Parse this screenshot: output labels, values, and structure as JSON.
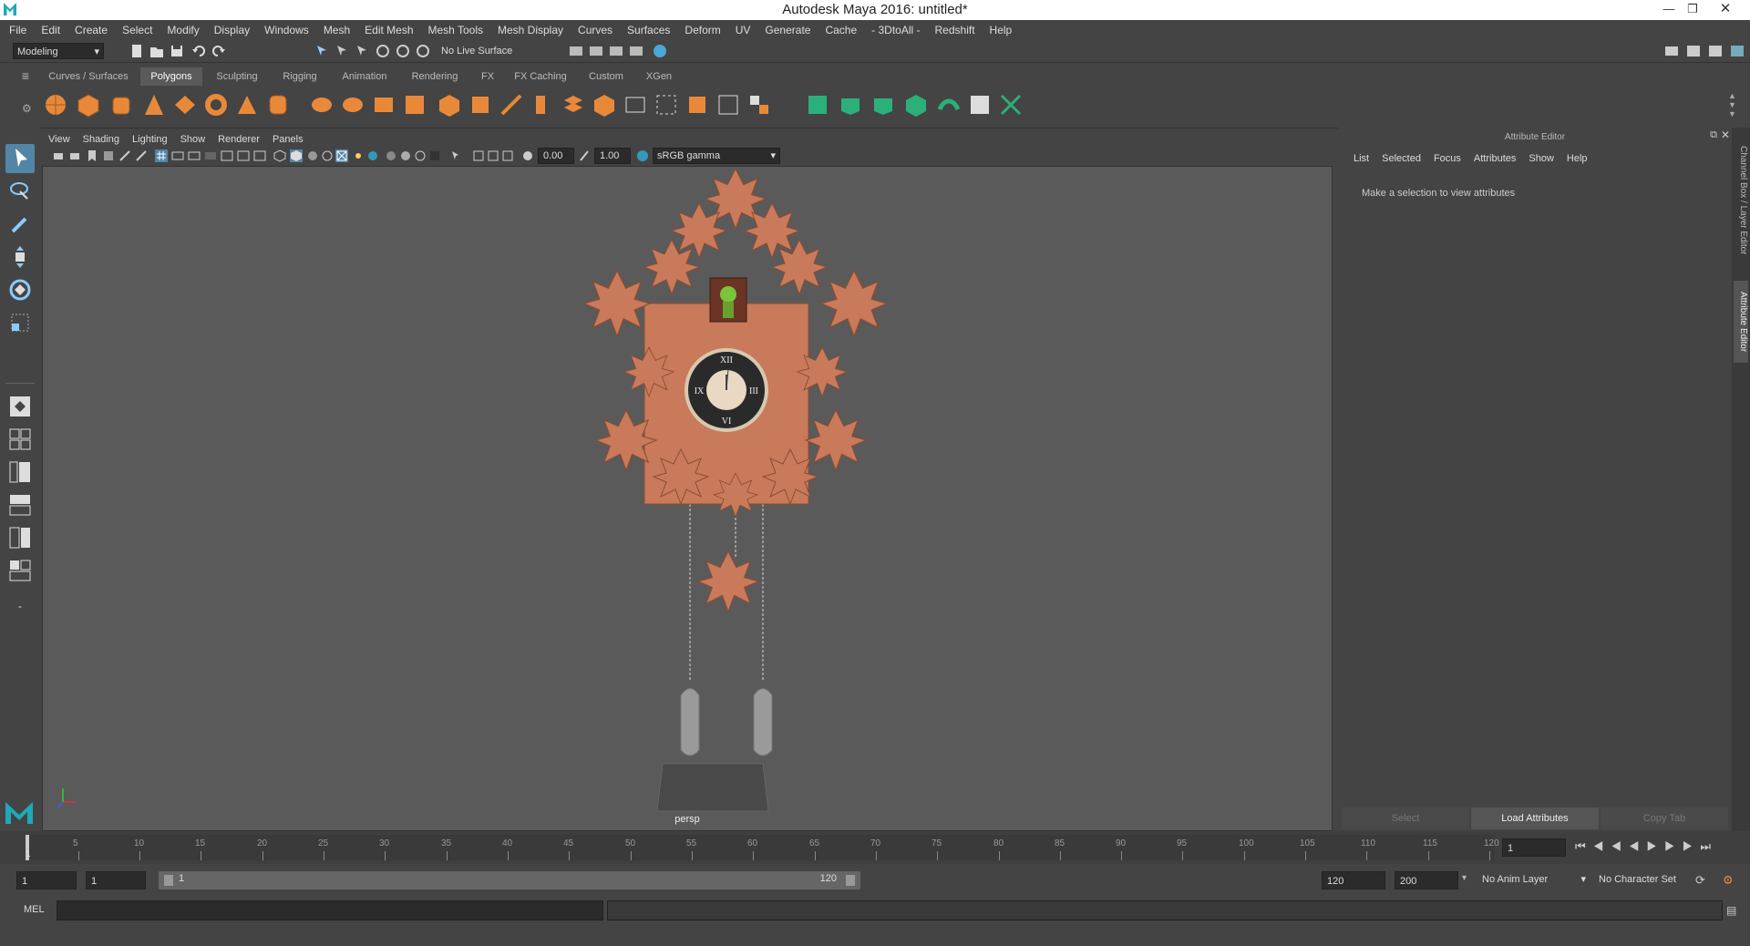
{
  "window": {
    "title": "Autodesk Maya 2016: untitled*"
  },
  "menubar": [
    "File",
    "Edit",
    "Create",
    "Select",
    "Modify",
    "Display",
    "Windows",
    "Mesh",
    "Edit Mesh",
    "Mesh Tools",
    "Mesh Display",
    "Curves",
    "Surfaces",
    "Deform",
    "UV",
    "Generate",
    "Cache",
    "- 3DtoAll -",
    "Redshift",
    "Help"
  ],
  "status": {
    "menuset": "Modeling",
    "live_surface": "No Live Surface"
  },
  "shelf": {
    "tabs": [
      "Curves / Surfaces",
      "Polygons",
      "Sculpting",
      "Rigging",
      "Animation",
      "Rendering",
      "FX",
      "FX Caching",
      "Custom",
      "XGen"
    ],
    "active_tab": "Polygons"
  },
  "viewport": {
    "menu": [
      "View",
      "Shading",
      "Lighting",
      "Show",
      "Renderer",
      "Panels"
    ],
    "exposure": "0.00",
    "gamma": "1.00",
    "color_space": "sRGB gamma",
    "camera_label": "persp"
  },
  "attribute_editor": {
    "header": "Attribute Editor",
    "menu": [
      "List",
      "Selected",
      "Focus",
      "Attributes",
      "Show",
      "Help"
    ],
    "message": "Make a selection to view attributes",
    "buttons": {
      "select": "Select",
      "load": "Load Attributes",
      "copy": "Copy Tab"
    }
  },
  "side_tabs": {
    "channel_box": "Channel Box / Layer Editor",
    "attribute_editor": "Attribute Editor"
  },
  "timeline": {
    "ticks": [
      "5",
      "10",
      "15",
      "20",
      "25",
      "30",
      "35",
      "40",
      "45",
      "50",
      "55",
      "60",
      "65",
      "70",
      "75",
      "80",
      "85",
      "90",
      "95",
      "100",
      "105",
      "110",
      "115",
      "120"
    ],
    "start_label": "1",
    "current_frame": "1"
  },
  "range": {
    "start": "1",
    "playback_start": "1",
    "slider_start": "1",
    "slider_end": "120",
    "playback_end": "120",
    "end": "200",
    "anim_layer": "No Anim Layer",
    "character_set": "No Character Set"
  },
  "command": {
    "language": "MEL"
  },
  "colors": {
    "accent": "#5285a6",
    "clock_wood": "#c97a5a",
    "viewport_bg": "#5a5a5a"
  }
}
